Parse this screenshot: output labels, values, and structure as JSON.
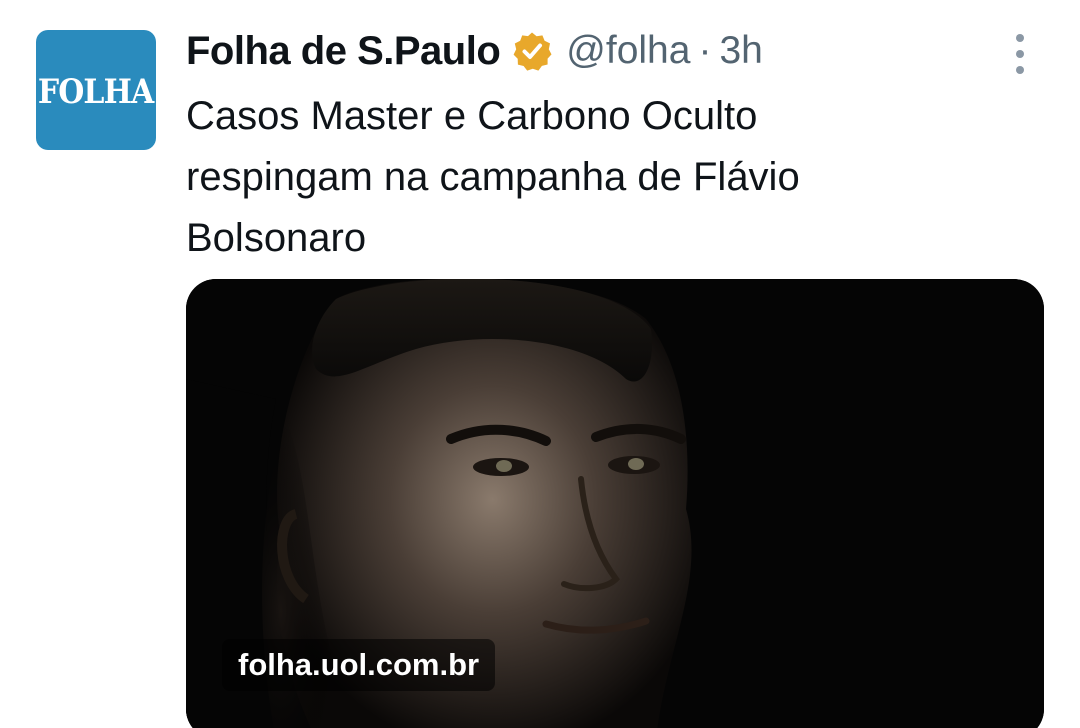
{
  "account": {
    "avatar_text": "FOLHA",
    "display_name": "Folha de S.Paulo",
    "handle": "@folha",
    "separator": "·",
    "timestamp": "3h"
  },
  "tweet": {
    "text": "Casos Master e Carbono Oculto respingam na campanha de Flávio Bolsonaro"
  },
  "media": {
    "domain": "folha.uol.com.br"
  },
  "colors": {
    "avatar_bg": "#2a8bbd",
    "verified_badge": "#e8a82b",
    "text_primary": "#0f1419",
    "text_secondary": "#536471"
  },
  "icons": {
    "verified": "verified-badge-icon",
    "more": "more-vertical-icon"
  }
}
